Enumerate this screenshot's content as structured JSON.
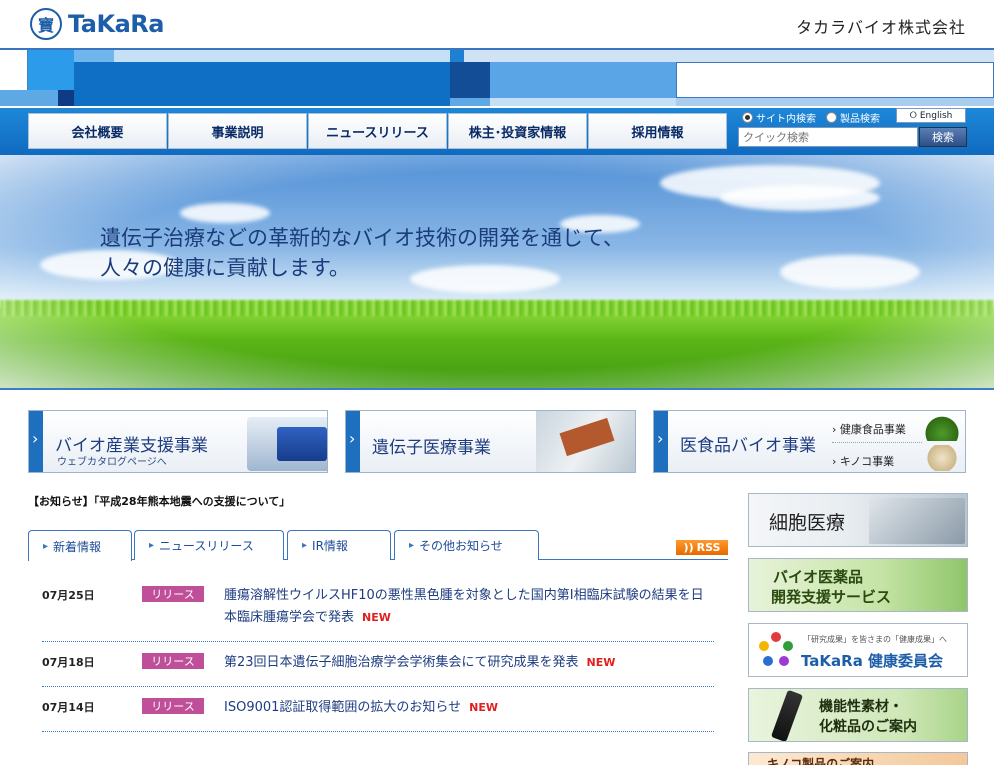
{
  "header": {
    "logo_mark": "寶",
    "logo_text": "TaKaRa",
    "company_name": "タカラバイオ株式会社"
  },
  "nav": {
    "items": [
      {
        "label": "会社概要"
      },
      {
        "label": "事業説明"
      },
      {
        "label": "ニュースリリース"
      },
      {
        "label": "株主･投資家情報"
      },
      {
        "label": "採用情報"
      }
    ]
  },
  "search": {
    "radio_site": "サイト内検索",
    "radio_product": "製品検索",
    "english": "English",
    "placeholder": "クイック検索",
    "button": "検索"
  },
  "hero": {
    "line1": "遺伝子治療などの革新的なバイオ技術の開発を通じて、",
    "line2": "人々の健康に貢献します。"
  },
  "business": {
    "bio_title": "バイオ産業支援事業",
    "bio_sub": "ウェブカタログページへ",
    "gene_title": "遺伝子医療事業",
    "food_title": "医食品バイオ事業",
    "food_link1": "健康食品事業",
    "food_link2": "キノコ事業"
  },
  "notice": "【お知らせ】「平成28年熊本地震への支援について」",
  "tabs": [
    {
      "label": "新着情報"
    },
    {
      "label": "ニュースリリース"
    },
    {
      "label": "IR情報"
    },
    {
      "label": "その他お知らせ"
    }
  ],
  "rss_label": "RSS",
  "news": [
    {
      "date": "07月25日",
      "badge": "リリース",
      "text": "腫瘍溶解性ウイルスHF10の悪性黒色腫を対象とした国内第I相臨床試験の結果を日本臨床腫瘍学会で発表",
      "new": "NEW"
    },
    {
      "date": "07月18日",
      "badge": "リリース",
      "text": "第23回日本遺伝子細胞治療学会学術集会にて研究成果を発表",
      "new": "NEW"
    },
    {
      "date": "07月14日",
      "badge": "リリース",
      "text": "ISO9001認証取得範囲の拡大のお知らせ",
      "new": "NEW"
    }
  ],
  "side": {
    "cell_title": "細胞医療",
    "biopharma_line1": "バイオ医薬品",
    "biopharma_line2": "開発支援サービス",
    "health_caption": "「研究成果」を皆さまの「健康成果」へ",
    "health_title": "TaKaRa 健康委員会",
    "func_line1": "機能性素材・",
    "func_line2": "化粧品のご案内",
    "mushroom_title": "キノコ製品のご案内"
  },
  "colors": {
    "brand_blue": "#1d5ea8",
    "nav_blue": "#1e87d8",
    "badge_pink": "#c04f9a",
    "new_red": "#e02020",
    "rss_orange": "#ff9a2e"
  }
}
